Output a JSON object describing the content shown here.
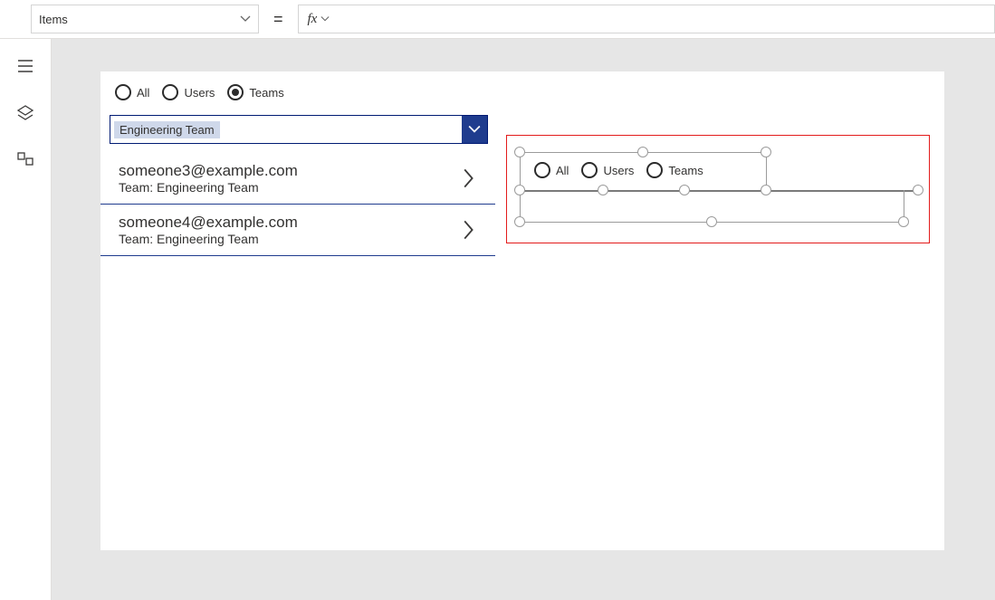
{
  "formula_bar": {
    "property": "Items",
    "equals": "=",
    "fx_label": "fx"
  },
  "filter_options": {
    "all": "All",
    "users": "Users",
    "teams": "Teams",
    "selected": "teams"
  },
  "combo": {
    "value": "Engineering Team"
  },
  "results": [
    {
      "email": "someone3@example.com",
      "team": "Team: Engineering Team"
    },
    {
      "email": "someone4@example.com",
      "team": "Team: Engineering Team"
    }
  ],
  "right_filter_options": {
    "all": "All",
    "users": "Users",
    "teams": "Teams"
  }
}
